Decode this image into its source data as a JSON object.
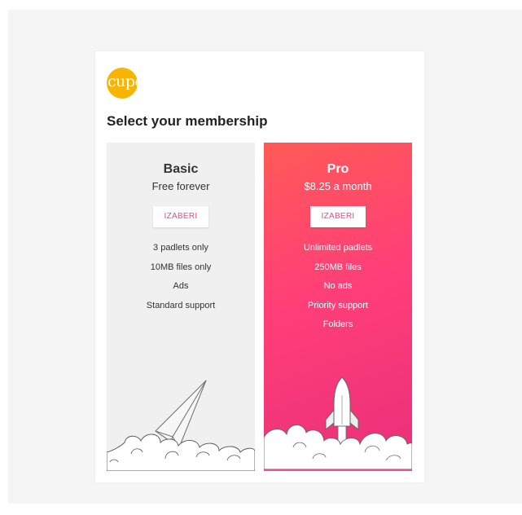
{
  "page": {
    "logo_text": "cupe",
    "heading": "Select your membership"
  },
  "plans": [
    {
      "name": "Basic",
      "price": "Free forever",
      "button_label": "IZABERI",
      "features": [
        "3 padlets only",
        "10MB files only",
        "Ads",
        "Standard support"
      ]
    },
    {
      "name": "Pro",
      "price": "$8.25 a month",
      "button_label": "IZABERI",
      "features": [
        "Unlimited padlets",
        "250MB files",
        "No ads",
        "Priority support",
        "Folders"
      ]
    }
  ],
  "colors": {
    "logo": "#f7b500",
    "pro_gradient_start": "#ff5a56",
    "pro_gradient_end": "#ea2f7a",
    "button_text": "#e84c7d"
  },
  "icons": [
    "paper-plane-icon",
    "rocket-icon",
    "clouds-icon"
  ]
}
